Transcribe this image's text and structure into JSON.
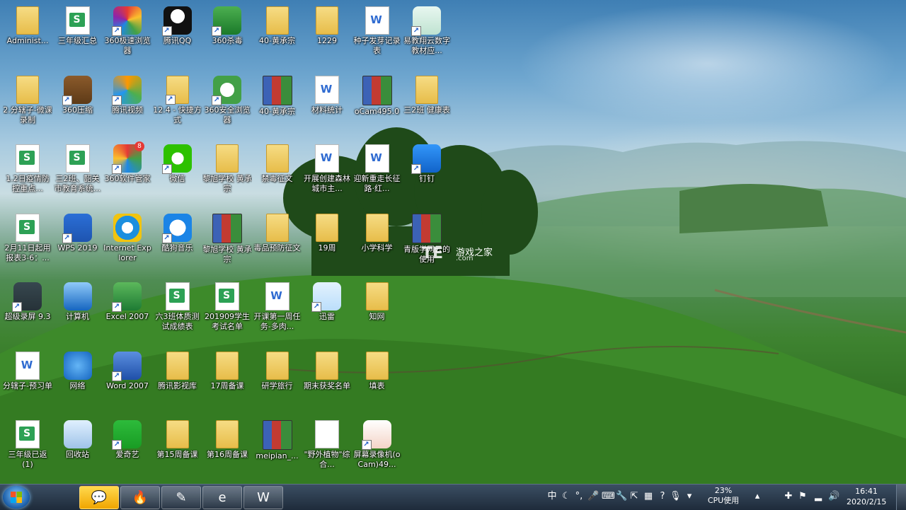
{
  "desktop": {
    "icons": [
      {
        "label": "Administ...",
        "glyph": "user-folder-icon",
        "col": 0,
        "row": 0,
        "shortcut": false
      },
      {
        "label": "三年级汇总",
        "glyph": "spreadsheet-file-icon",
        "col": 1,
        "row": 0,
        "shortcut": false
      },
      {
        "label": "360极速浏览器",
        "glyph": "360-browser-icon",
        "col": 2,
        "row": 0,
        "shortcut": true
      },
      {
        "label": "腾讯QQ",
        "glyph": "qq-penguin-icon",
        "col": 3,
        "row": 0,
        "shortcut": true
      },
      {
        "label": "360杀毒",
        "glyph": "360-antivirus-icon",
        "col": 4,
        "row": 0,
        "shortcut": true
      },
      {
        "label": "40-黄承宗",
        "glyph": "folder-icon",
        "col": 5,
        "row": 0,
        "shortcut": false
      },
      {
        "label": "1229",
        "glyph": "folder-icon",
        "col": 6,
        "row": 0,
        "shortcut": false
      },
      {
        "label": "种子发芽记录表",
        "glyph": "word-document-icon",
        "col": 7,
        "row": 0,
        "shortcut": false
      },
      {
        "label": "易教翔云数字教材应...",
        "glyph": "textbook-app-icon",
        "col": 8,
        "row": 0,
        "shortcut": true
      },
      {
        "label": "2.分辖子-微课录制",
        "glyph": "folder-icon",
        "col": 0,
        "row": 1,
        "shortcut": false
      },
      {
        "label": "360压缩",
        "glyph": "360-zip-icon",
        "col": 1,
        "row": 1,
        "shortcut": true
      },
      {
        "label": "腾讯视频",
        "glyph": "tencent-video-icon",
        "col": 2,
        "row": 1,
        "shortcut": true
      },
      {
        "label": "12.4 - 快捷方式",
        "glyph": "folder-icon",
        "col": 3,
        "row": 1,
        "shortcut": true
      },
      {
        "label": "360安全浏览器",
        "glyph": "360-secure-browser-icon",
        "col": 4,
        "row": 1,
        "shortcut": true
      },
      {
        "label": "40-黄承宗",
        "glyph": "winrar-archive-icon",
        "col": 5,
        "row": 1,
        "shortcut": false
      },
      {
        "label": "材料统计",
        "glyph": "word-document-icon",
        "col": 6,
        "row": 1,
        "shortcut": false
      },
      {
        "label": "oCam495.0",
        "glyph": "winrar-archive-icon",
        "col": 7,
        "row": 1,
        "shortcut": false
      },
      {
        "label": "三2班 健康表",
        "glyph": "folder-icon",
        "col": 8,
        "row": 1,
        "shortcut": false
      },
      {
        "label": "1.2日疫情防控重点...",
        "glyph": "spreadsheet-file-icon",
        "col": 0,
        "row": 2,
        "shortcut": false
      },
      {
        "label": "三2班、韶关市教育系统...",
        "glyph": "spreadsheet-file-icon",
        "col": 1,
        "row": 2,
        "shortcut": false
      },
      {
        "label": "360软件管家",
        "glyph": "360-software-manager-icon",
        "col": 2,
        "row": 2,
        "shortcut": true,
        "badge": "8"
      },
      {
        "label": "微信",
        "glyph": "wechat-icon",
        "col": 3,
        "row": 2,
        "shortcut": true
      },
      {
        "label": "黎旭学校 黄承宗",
        "glyph": "folder-icon",
        "col": 4,
        "row": 2,
        "shortcut": false
      },
      {
        "label": "禁毒征文",
        "glyph": "folder-icon",
        "col": 5,
        "row": 2,
        "shortcut": false
      },
      {
        "label": "开展创建森林城市主...",
        "glyph": "word-document-icon",
        "col": 6,
        "row": 2,
        "shortcut": false
      },
      {
        "label": "迎新重走长征路·红...",
        "glyph": "word-document-icon",
        "col": 7,
        "row": 2,
        "shortcut": false
      },
      {
        "label": "钉钉",
        "glyph": "dingtalk-icon",
        "col": 8,
        "row": 2,
        "shortcut": true
      },
      {
        "label": "2月11日起用报表3-6：...",
        "glyph": "spreadsheet-file-icon",
        "col": 0,
        "row": 3,
        "shortcut": false
      },
      {
        "label": "WPS 2019",
        "glyph": "wps-icon",
        "col": 1,
        "row": 3,
        "shortcut": true
      },
      {
        "label": "Internet Explorer",
        "glyph": "internet-explorer-icon",
        "col": 2,
        "row": 3,
        "shortcut": false
      },
      {
        "label": "酷狗音乐",
        "glyph": "kugou-music-icon",
        "col": 3,
        "row": 3,
        "shortcut": true
      },
      {
        "label": "黎旭学校 黄承宗",
        "glyph": "winrar-archive-icon",
        "col": 4,
        "row": 3,
        "shortcut": false
      },
      {
        "label": "毒品预防征文",
        "glyph": "folder-icon",
        "col": 5,
        "row": 3,
        "shortcut": false
      },
      {
        "label": "19周",
        "glyph": "folder-icon",
        "col": 6,
        "row": 3,
        "shortcut": false
      },
      {
        "label": "小学科学",
        "glyph": "folder-icon",
        "col": 7,
        "row": 3,
        "shortcut": false
      },
      {
        "label": "青版学网云的使用",
        "glyph": "winrar-archive-icon",
        "col": 8,
        "row": 3,
        "shortcut": false
      },
      {
        "label": "超级录屏 9.3",
        "glyph": "screen-recorder-icon",
        "col": 0,
        "row": 4,
        "shortcut": true
      },
      {
        "label": "计算机",
        "glyph": "computer-icon",
        "col": 1,
        "row": 4,
        "shortcut": false
      },
      {
        "label": "Excel 2007",
        "glyph": "excel-icon",
        "col": 2,
        "row": 4,
        "shortcut": true
      },
      {
        "label": "六3班体质测试成绩表",
        "glyph": "spreadsheet-file-icon",
        "col": 3,
        "row": 4,
        "shortcut": false
      },
      {
        "label": "201909学生考试名单",
        "glyph": "spreadsheet-file-icon",
        "col": 4,
        "row": 4,
        "shortcut": false
      },
      {
        "label": "开课第一周任务-多肉...",
        "glyph": "word-document-icon",
        "col": 5,
        "row": 4,
        "shortcut": false
      },
      {
        "label": "迅雷",
        "glyph": "thunder-download-icon",
        "col": 6,
        "row": 4,
        "shortcut": true
      },
      {
        "label": "知网",
        "glyph": "folder-icon",
        "col": 7,
        "row": 4,
        "shortcut": false
      },
      {
        "label": "分辖子-预习单",
        "glyph": "word-document-icon",
        "col": 0,
        "row": 5,
        "shortcut": false
      },
      {
        "label": "网络",
        "glyph": "network-icon",
        "col": 1,
        "row": 5,
        "shortcut": false
      },
      {
        "label": "Word 2007",
        "glyph": "word-app-icon",
        "col": 2,
        "row": 5,
        "shortcut": true
      },
      {
        "label": "腾讯影视库",
        "glyph": "video-folder-icon",
        "col": 3,
        "row": 5,
        "shortcut": false
      },
      {
        "label": "17周备课",
        "glyph": "folder-icon",
        "col": 4,
        "row": 5,
        "shortcut": false
      },
      {
        "label": "研学旅行",
        "glyph": "folder-icon",
        "col": 5,
        "row": 5,
        "shortcut": false
      },
      {
        "label": "期末获奖名单",
        "glyph": "folder-icon",
        "col": 6,
        "row": 5,
        "shortcut": false
      },
      {
        "label": "填表",
        "glyph": "folder-icon",
        "col": 7,
        "row": 5,
        "shortcut": false
      },
      {
        "label": "三年级已返(1)",
        "glyph": "spreadsheet-file-icon",
        "col": 0,
        "row": 6,
        "shortcut": false
      },
      {
        "label": "回收站",
        "glyph": "recycle-bin-icon",
        "col": 1,
        "row": 6,
        "shortcut": false
      },
      {
        "label": "爱奇艺",
        "glyph": "iqiyi-icon",
        "col": 2,
        "row": 6,
        "shortcut": true
      },
      {
        "label": "第15周备课",
        "glyph": "folder-icon",
        "col": 3,
        "row": 6,
        "shortcut": false
      },
      {
        "label": "第16周备课",
        "glyph": "folder-icon",
        "col": 4,
        "row": 6,
        "shortcut": false
      },
      {
        "label": "meipian_...",
        "glyph": "winrar-archive-icon",
        "col": 5,
        "row": 6,
        "shortcut": false
      },
      {
        "label": "\"野外植物\"综合...",
        "glyph": "blank-document-icon",
        "col": 6,
        "row": 6,
        "shortcut": false
      },
      {
        "label": "屏幕录像机(oCam)49...",
        "glyph": "ocam-recorder-icon",
        "col": 7,
        "row": 6,
        "shortcut": true
      }
    ]
  },
  "watermark": {
    "logo": "TE",
    "title": "游戏之家",
    "subtitle": ".com"
  },
  "taskbar": {
    "pinned": [
      {
        "name": "wechat",
        "glyph": "💬",
        "active": true
      },
      {
        "name": "fire-app",
        "glyph": "🔥",
        "active": false
      },
      {
        "name": "textbook-app",
        "glyph": "✎",
        "active": false
      },
      {
        "name": "360-browser",
        "glyph": "e",
        "active": false
      },
      {
        "name": "wps",
        "glyph": "W",
        "active": false
      }
    ],
    "tray": {
      "ime": "中",
      "cpu_percent": "23%",
      "cpu_label": "CPU使用",
      "time": "16:41",
      "date": "2020/2/15"
    }
  },
  "colors": {
    "label_text": "#ffffff",
    "folder": "#e7bd4a",
    "taskbar": "#1e2b3a"
  }
}
